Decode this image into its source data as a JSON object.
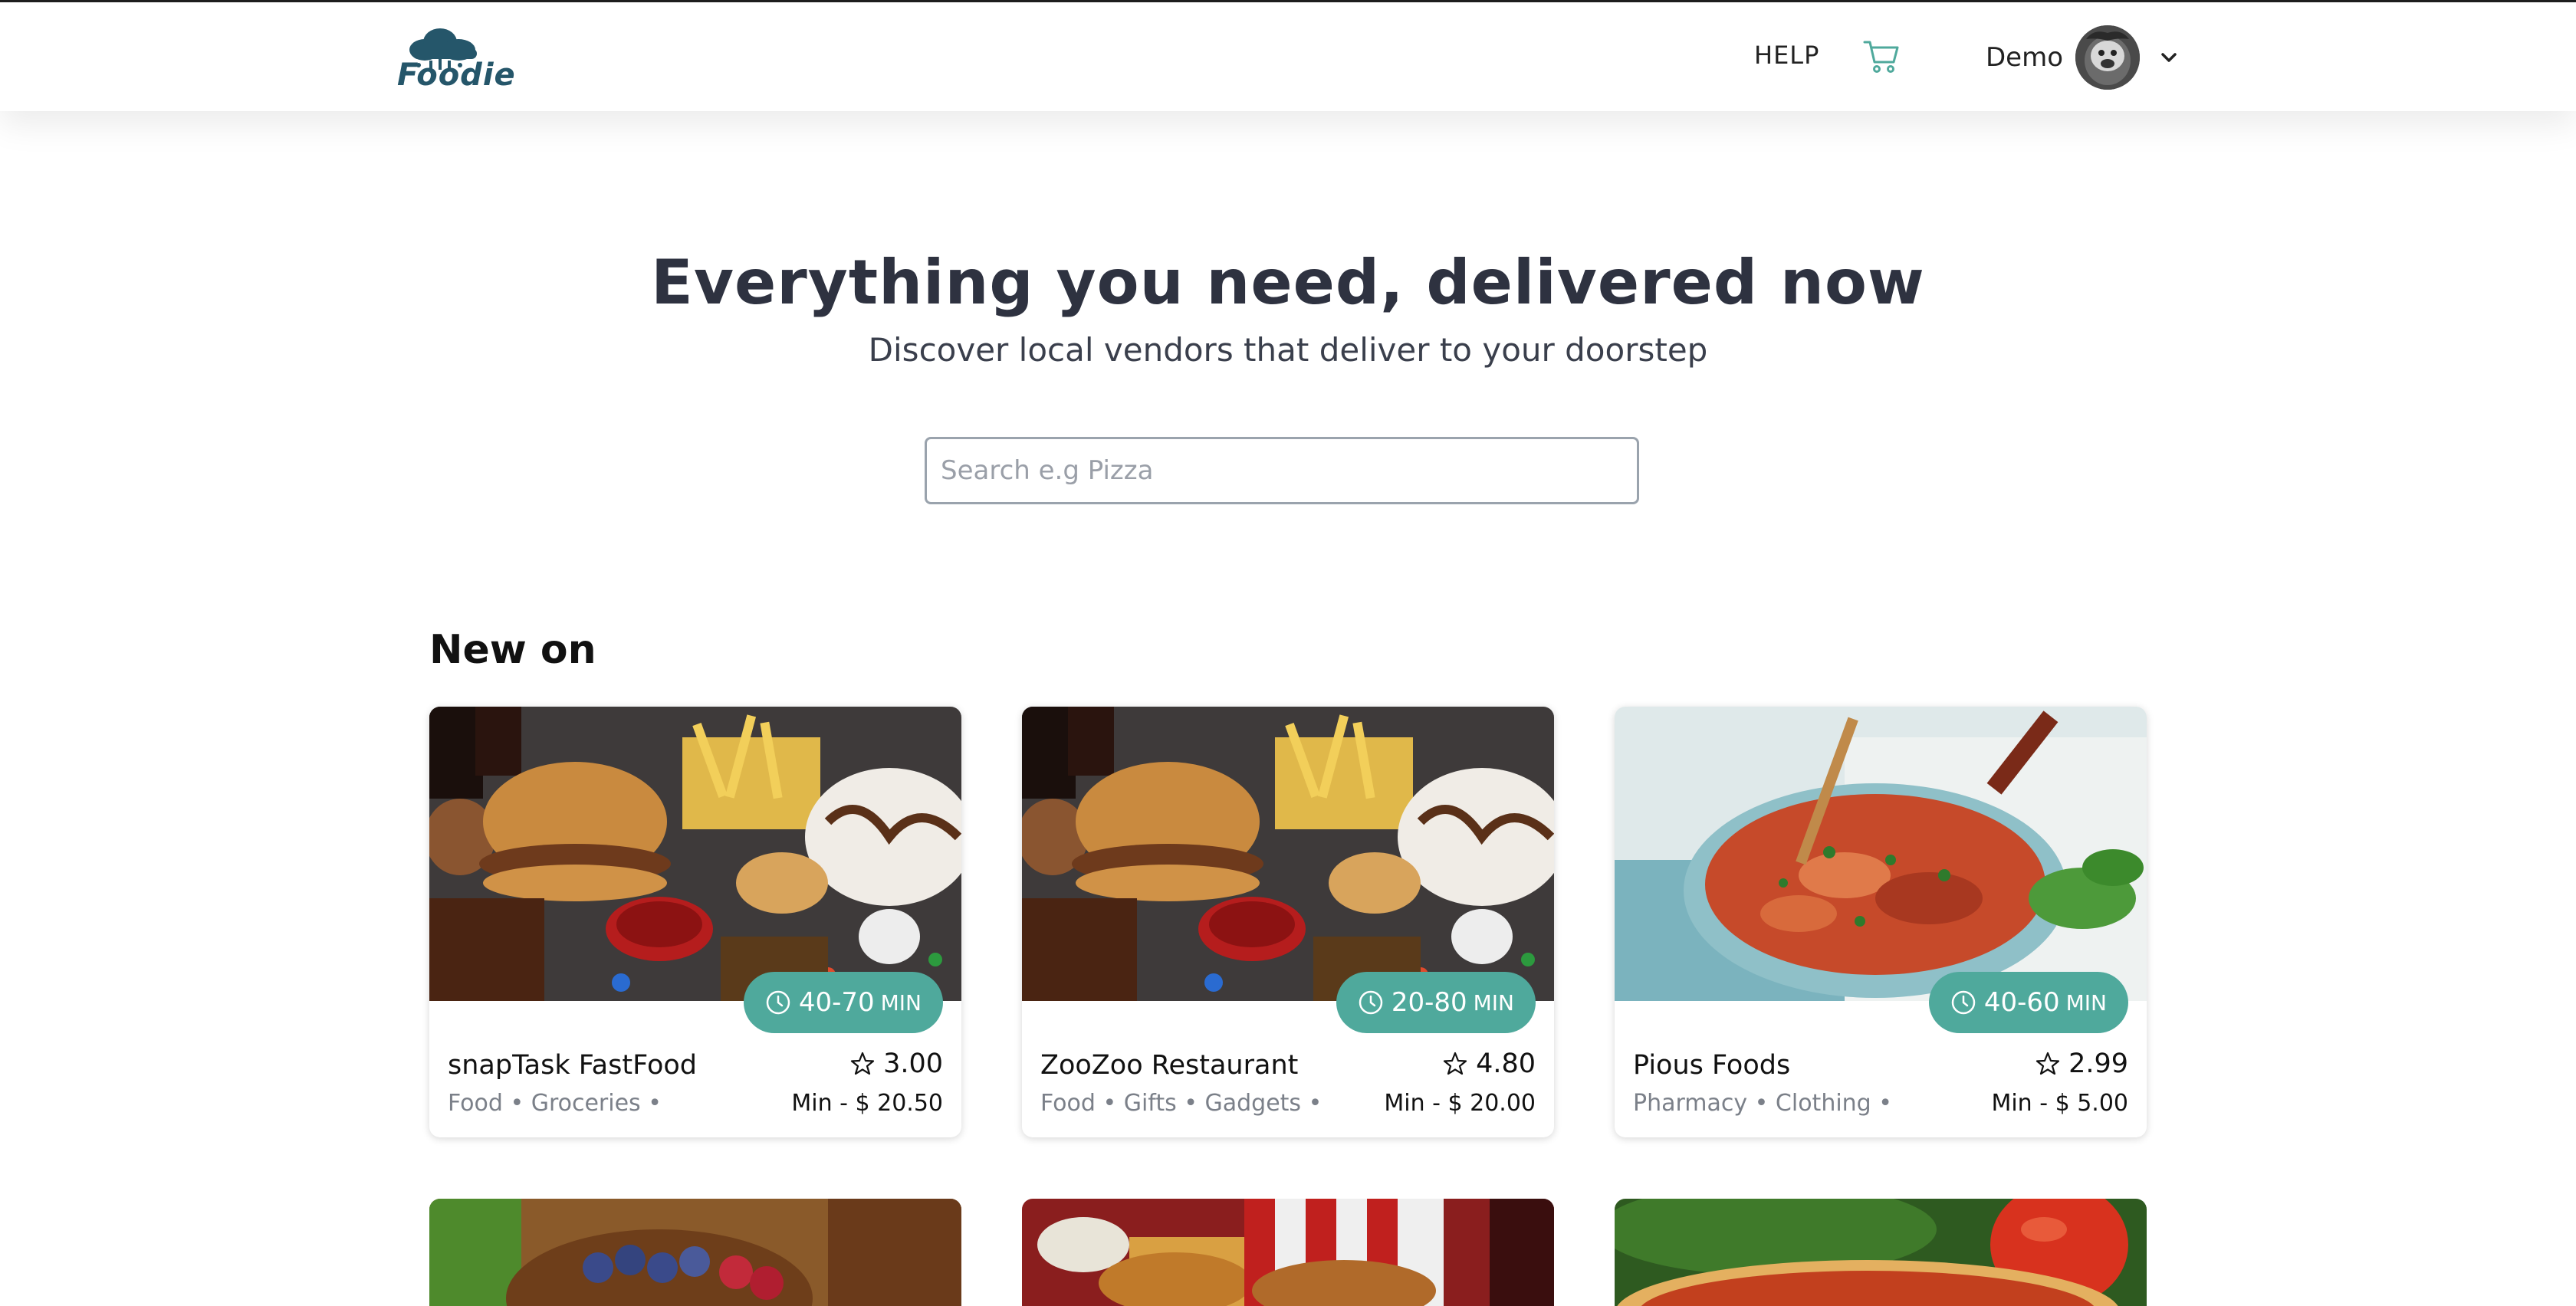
{
  "app": {
    "brand": "Foodie",
    "brand_color": "#25566a",
    "accent_color": "#4fa99c"
  },
  "nav": {
    "help_label": "HELP",
    "cart_icon": "shopping-cart-icon",
    "username": "Demo",
    "user_menu_icon": "chevron-down-icon"
  },
  "hero": {
    "title": "Everything you need, delivered now",
    "subtitle": "Discover local vendors that deliver to your doorstep",
    "search_placeholder": "Search e.g Pizza",
    "search_value": ""
  },
  "section": {
    "title": "New on"
  },
  "vendors": [
    {
      "name": "snapTask FastFood",
      "rating": "3.00",
      "delivery_time": "40-70",
      "delivery_unit": "MIN",
      "categories": "Food • Groceries •",
      "minimum": "Min - $ 20.50",
      "image": "burger-fries-dessert-photo"
    },
    {
      "name": "ZooZoo Restaurant",
      "rating": "4.80",
      "delivery_time": "20-80",
      "delivery_unit": "MIN",
      "categories": "Food • Gifts • Gadgets •",
      "minimum": "Min - $ 20.00",
      "image": "burger-fries-dessert-photo"
    },
    {
      "name": "Pious Foods",
      "rating": "2.99",
      "delivery_time": "40-60",
      "delivery_unit": "MIN",
      "categories": "Pharmacy • Clothing •",
      "minimum": "Min - $ 5.00",
      "image": "pan-of-stew-photo"
    }
  ],
  "more_vendors_images": [
    "berries-bowl-photo",
    "fried-chicken-bucket-photo",
    "pizza-tomato-photo"
  ]
}
